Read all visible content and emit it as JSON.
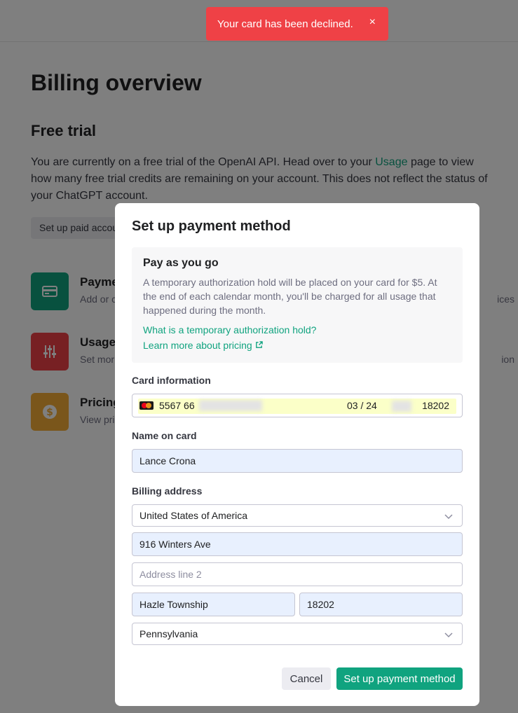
{
  "page": {
    "title": "Billing overview",
    "section_title": "Free trial",
    "trial_text_before": "You are currently on a free trial of the OpenAI API. Head over to your ",
    "trial_text_link": "Usage",
    "trial_text_after": " page to view how many free trial credits are remaining on your account. This does not reflect the status of your ChatGPT account.",
    "setup_paid_button": "Set up paid account",
    "cards": [
      {
        "title": "Payment methods",
        "desc": "Add or c",
        "desc_right": "ices",
        "icon": "credit-card-icon",
        "color": "#10a37f"
      },
      {
        "title": "Usage limits",
        "desc": "Set mor",
        "desc_right": "ion",
        "icon": "sliders-icon",
        "color": "#ef4146"
      },
      {
        "title": "Pricing",
        "desc": "View pri",
        "desc_right": "",
        "icon": "dollar-icon",
        "color": "#f4ac36"
      }
    ]
  },
  "toast": {
    "message": "Your card has been declined.",
    "close": "×"
  },
  "modal": {
    "title": "Set up payment method",
    "payg": {
      "title": "Pay as you go",
      "text": "A temporary authorization hold will be placed on your card for $5. At the end of each calendar month, you'll be charged for all usage that happened during the month.",
      "link1": "What is a temporary authorization hold?",
      "link2": "Learn more about pricing"
    },
    "card_info_label": "Card information",
    "card": {
      "number_prefix": "5567 66",
      "expiry": "03 / 24",
      "zip": "18202"
    },
    "name_label": "Name on card",
    "name_value": "Lance Crona",
    "billing_label": "Billing address",
    "country": "United States of America",
    "address1": "916 Winters Ave",
    "address2_placeholder": "Address line 2",
    "city": "Hazle Township",
    "postal": "18202",
    "state": "Pennsylvania",
    "cancel_label": "Cancel",
    "submit_label": "Set up payment method"
  },
  "colors": {
    "accent": "#10a37f",
    "danger": "#ef4146",
    "autofill": "#e8f0fe"
  }
}
